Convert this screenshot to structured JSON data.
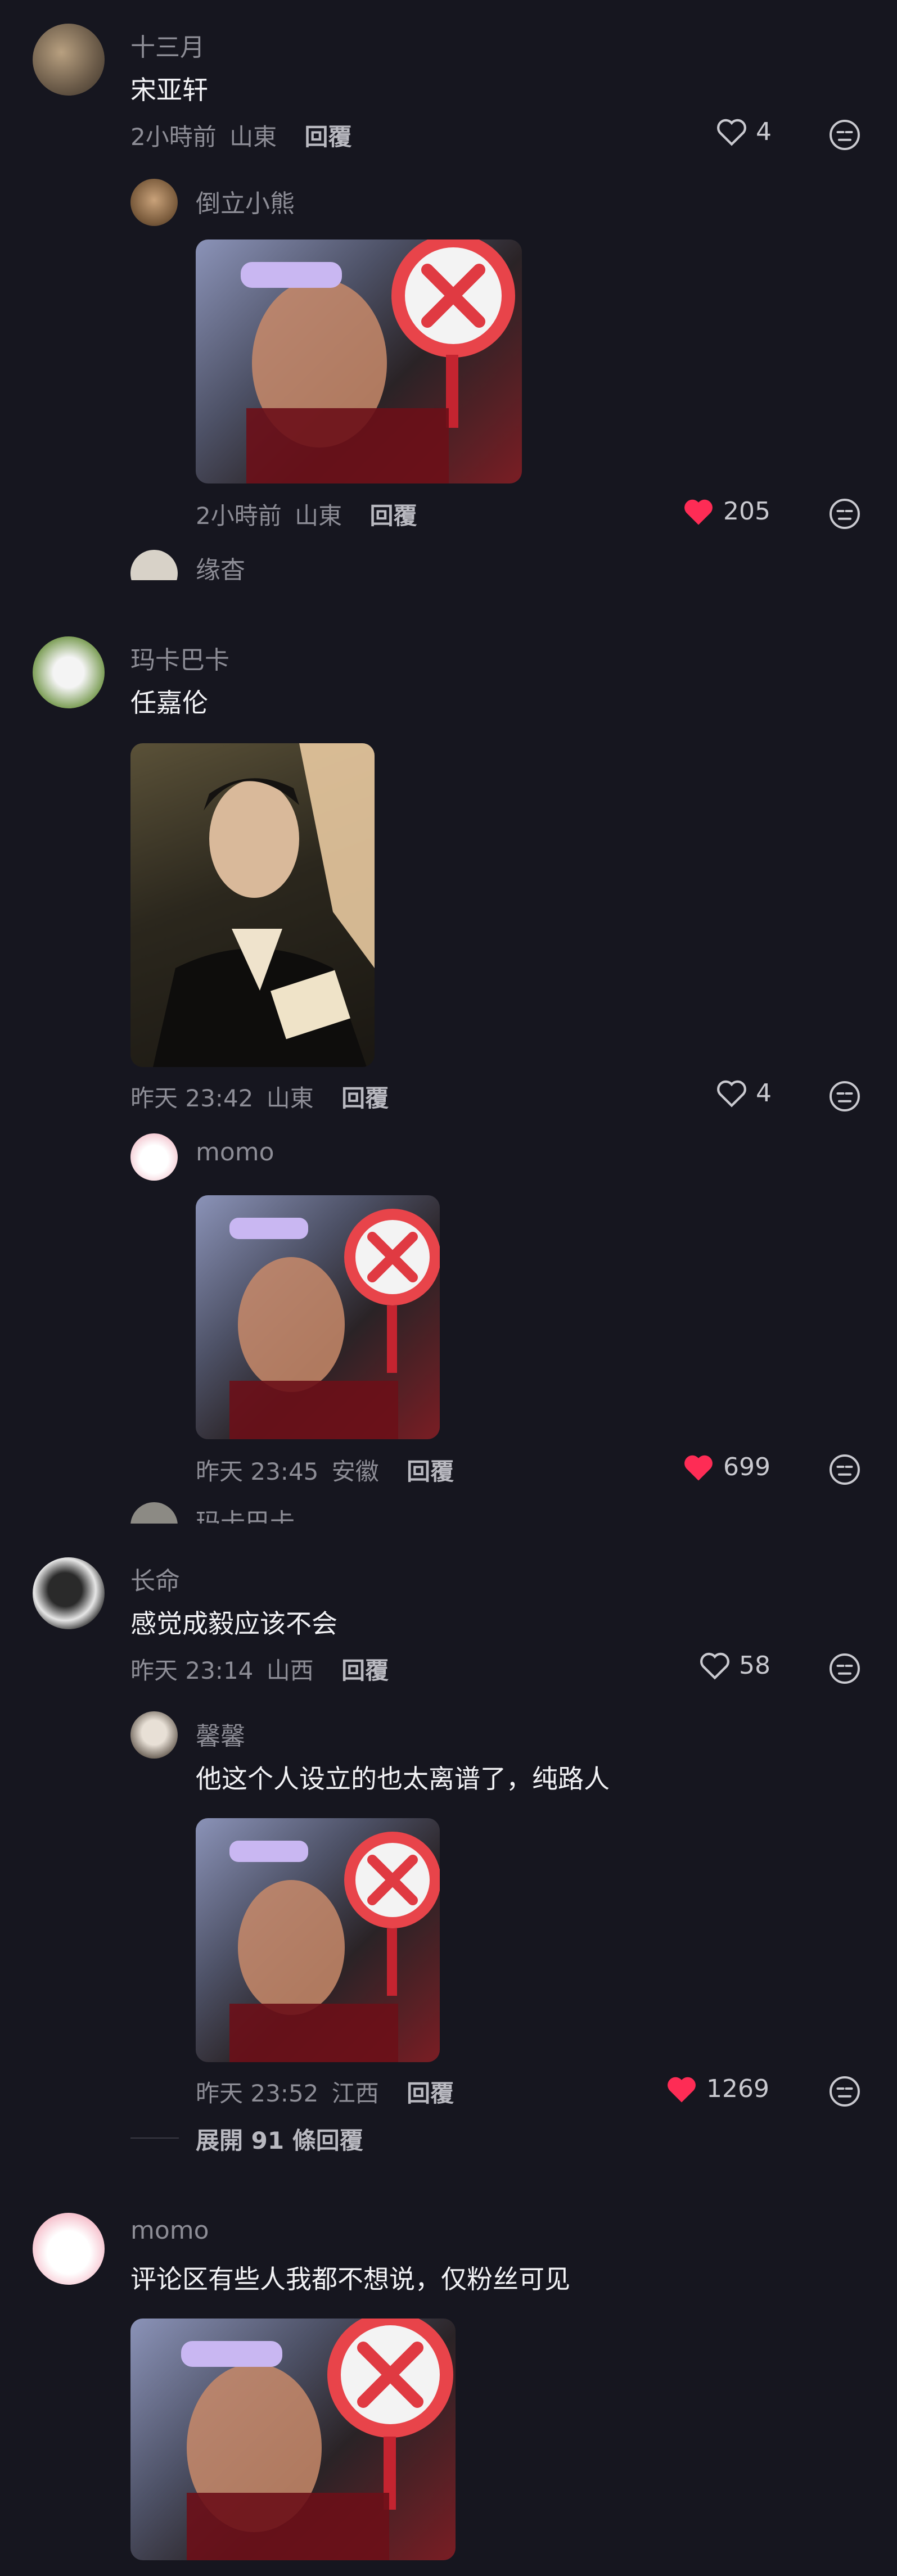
{
  "comments": [
    {
      "user": "十三月",
      "text": "宋亚轩",
      "time": "2小時前",
      "location": "山東",
      "reply_label": "回覆",
      "likes": "4",
      "replies": [
        {
          "user": "倒立小熊",
          "time": "2小時前",
          "location": "山東",
          "reply_label": "回覆",
          "likes": "205",
          "liked": true
        }
      ],
      "cut_reply_user": "缘杳"
    },
    {
      "user": "玛卡巴卡",
      "text": "任嘉伦",
      "time": "昨天 23:42",
      "location": "山東",
      "reply_label": "回覆",
      "likes": "4",
      "replies": [
        {
          "user": "momo",
          "time": "昨天 23:45",
          "location": "安徽",
          "reply_label": "回覆",
          "likes": "699",
          "liked": true
        }
      ],
      "cut_reply_user": "玛卡巴卡"
    },
    {
      "user": "长命",
      "text": "感觉成毅应该不会",
      "time": "昨天 23:14",
      "location": "山西",
      "reply_label": "回覆",
      "likes": "58",
      "replies": [
        {
          "user": "馨馨",
          "text": "他这个人设立的也太离谱了，纯路人",
          "time": "昨天 23:52",
          "location": "江西",
          "reply_label": "回覆",
          "likes": "1269",
          "liked": true
        }
      ],
      "expand_label": "展開 91 條回覆"
    },
    {
      "user": "momo",
      "text": "评论区有些人我都不想说，仅粉丝可见"
    }
  ],
  "colors": {
    "background": "#16161f",
    "liked_heart": "#fe2c55",
    "name": "#8d8d96"
  }
}
